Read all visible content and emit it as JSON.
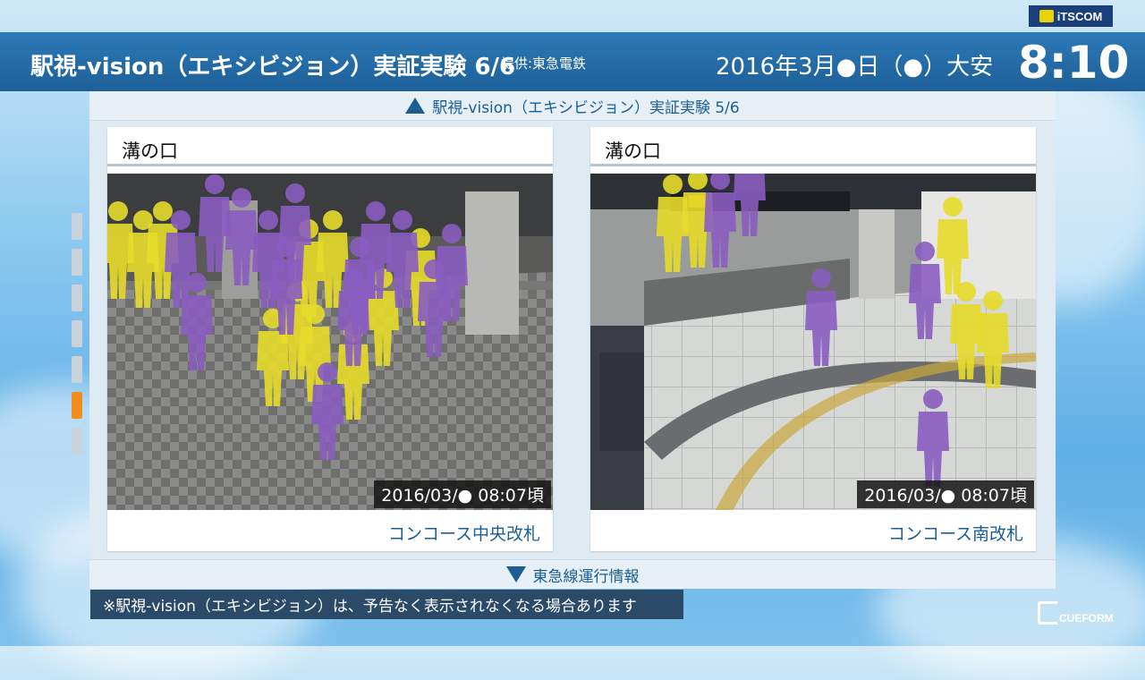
{
  "brand": {
    "logo_text": "iTSCOM",
    "footer_logo_text": "CUEFORM"
  },
  "header": {
    "title": "駅視-vision（エキシビジョン）実証実験 6/6",
    "provider": "提供:東急電鉄",
    "date": "2016年3月●日（●）大安",
    "time": "8:10"
  },
  "nav": {
    "prev_label": "駅視-vision（エキシビジョン）実証実験 5/6",
    "next_label": "東急線運行情報"
  },
  "cameras": [
    {
      "station": "溝の口",
      "timestamp": "2016/03/● 08:07頃",
      "location": "コンコース中央改札"
    },
    {
      "station": "溝の口",
      "timestamp": "2016/03/● 08:07頃",
      "location": "コンコース南改札"
    }
  ],
  "side_pages": {
    "count": 7,
    "active_index": 5
  },
  "notice": "※駅視-vision（エキシビジョン）は、予告なく表示されなくなる場合あります",
  "colors": {
    "header_bg": "#1e5f98",
    "accent_text": "#1a5e96",
    "person_purple": "#8a5cc0",
    "person_yellow": "#e5dc2a",
    "active_indicator": "#f28c1e"
  }
}
